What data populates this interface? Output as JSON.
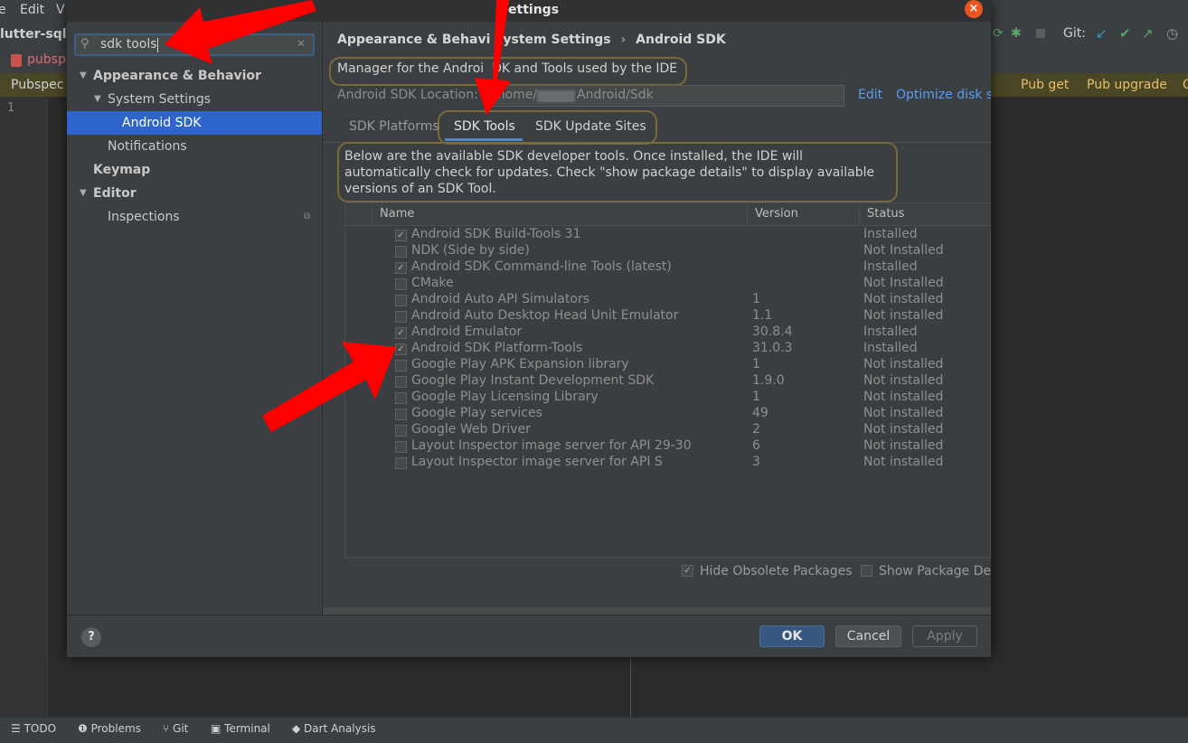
{
  "ide": {
    "menu": [
      "Edit",
      "V"
    ],
    "project_name": "lutter-sqlit",
    "file_tab": "pubsp",
    "pubspec_label": "Pubspec",
    "pub_get": "Pub get",
    "pub_upgrade": "Pub upgrade",
    "pub_extra": "C",
    "git_label": "Git:",
    "line_number": "1",
    "status_bar": [
      "TODO",
      "Problems",
      "Git",
      "Terminal",
      "Dart Analysis"
    ]
  },
  "dialog": {
    "title": "Settings",
    "close_icon": "close-icon",
    "search": {
      "value": "sdk tools",
      "clear_icon": "clear-icon"
    },
    "tree": [
      {
        "label": "Appearance & Behavior",
        "bold": true
      },
      {
        "label": "System Settings"
      },
      {
        "label": "Android SDK",
        "selected": true
      },
      {
        "label": "Notifications"
      },
      {
        "label": "Keymap",
        "bold": true
      },
      {
        "label": "Editor",
        "bold": true
      },
      {
        "label": "Inspections"
      }
    ],
    "breadcrumb": {
      "part1": "Appearance & Behavi",
      "part2": "ystem Settings",
      "separator": "›",
      "part3": "Android SDK"
    },
    "description": "Manager for the Androi  DK and Tools used by the IDE",
    "sdk_location_label": "Android SDK Location:",
    "sdk_location_value": "/home/",
    "sdk_location_suffix": "Android/Sdk",
    "edit_link": "Edit",
    "optimize_link": "Optimize disk s",
    "tabs": [
      "SDK Platforms",
      "SDK Tools",
      "SDK Update Sites"
    ],
    "active_tab": "SDK Tools",
    "info_text": "Below are the available SDK developer tools. Once installed, the IDE will automatically check for updates. Check \"show package details\" to display available versions of an SDK Tool.",
    "columns": [
      "Name",
      "Version",
      "Status"
    ],
    "rows": [
      {
        "checked": true,
        "name": "Android SDK Build-Tools 31",
        "version": "",
        "status": "Installed"
      },
      {
        "checked": false,
        "name": "NDK (Side by side)",
        "version": "",
        "status": "Not Installed"
      },
      {
        "checked": true,
        "name": "Android SDK Command-line Tools (latest)",
        "version": "",
        "status": "Installed"
      },
      {
        "checked": false,
        "name": "CMake",
        "version": "",
        "status": "Not Installed"
      },
      {
        "checked": false,
        "name": "Android Auto API Simulators",
        "version": "1",
        "status": "Not installed"
      },
      {
        "checked": false,
        "name": "Android Auto Desktop Head Unit Emulator",
        "version": "1.1",
        "status": "Not installed"
      },
      {
        "checked": true,
        "name": "Android Emulator",
        "version": "30.8.4",
        "status": "Installed"
      },
      {
        "checked": true,
        "name": "Android SDK Platform-Tools",
        "version": "31.0.3",
        "status": "Installed"
      },
      {
        "checked": false,
        "name": "Google Play APK Expansion library",
        "version": "1",
        "status": "Not installed"
      },
      {
        "checked": false,
        "name": "Google Play Instant Development SDK",
        "version": "1.9.0",
        "status": "Not installed"
      },
      {
        "checked": false,
        "name": "Google Play Licensing Library",
        "version": "1",
        "status": "Not installed"
      },
      {
        "checked": false,
        "name": "Google Play services",
        "version": "49",
        "status": "Not installed"
      },
      {
        "checked": false,
        "name": "Google Web Driver",
        "version": "2",
        "status": "Not installed"
      },
      {
        "checked": false,
        "name": "Layout Inspector image server for API 29-30",
        "version": "6",
        "status": "Not installed"
      },
      {
        "checked": false,
        "name": "Layout Inspector image server for API S",
        "version": "3",
        "status": "Not installed"
      }
    ],
    "hide_obsolete": {
      "label": "Hide Obsolete Packages",
      "checked": true
    },
    "show_details": {
      "label": "Show Package Det",
      "checked": false
    },
    "help_label": "?",
    "ok_label": "OK",
    "cancel_label": "Cancel",
    "apply_label": "Apply"
  },
  "colors": {
    "accent": "#2f65ca",
    "ok_button": "#365880",
    "annotation_arrow": "#ff0000",
    "highlight_outline": "#7a6a3a",
    "link": "#589df6"
  }
}
